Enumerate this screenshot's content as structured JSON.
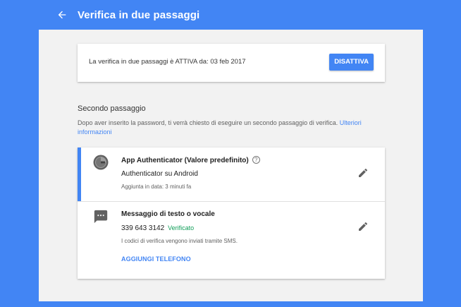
{
  "header": {
    "title": "Verifica in due passaggi",
    "back_icon": "arrow-left-icon"
  },
  "status": {
    "text": "La verifica in due passaggi è ATTIVA da: 03 feb 2017",
    "disable_label": "DISATTIVA"
  },
  "second_step": {
    "heading": "Secondo passaggio",
    "description": "Dopo aver inserito la password, ti verrà chiesto di eseguire un secondo passaggio di verifica.",
    "more_info_link": "Ulteriori informazioni"
  },
  "methods": [
    {
      "title": "App Authenticator (Valore predefinito)",
      "help_icon": "?",
      "value": "Authenticator su Android",
      "sub": "Aggiunta in data: 3 minuti fa",
      "icon": "authenticator-icon"
    },
    {
      "title": "Messaggio di testo o vocale",
      "value": "339 643 3142",
      "verified_label": "Verificato",
      "sub": "I codici di verifica vengono inviati tramite SMS.",
      "add_phone_label": "AGGIUNGI TELEFONO",
      "icon": "sms-icon"
    }
  ],
  "colors": {
    "brand_blue": "#4285f4",
    "verified_green": "#0f9d58",
    "panel_bg": "#f2f2f2"
  }
}
